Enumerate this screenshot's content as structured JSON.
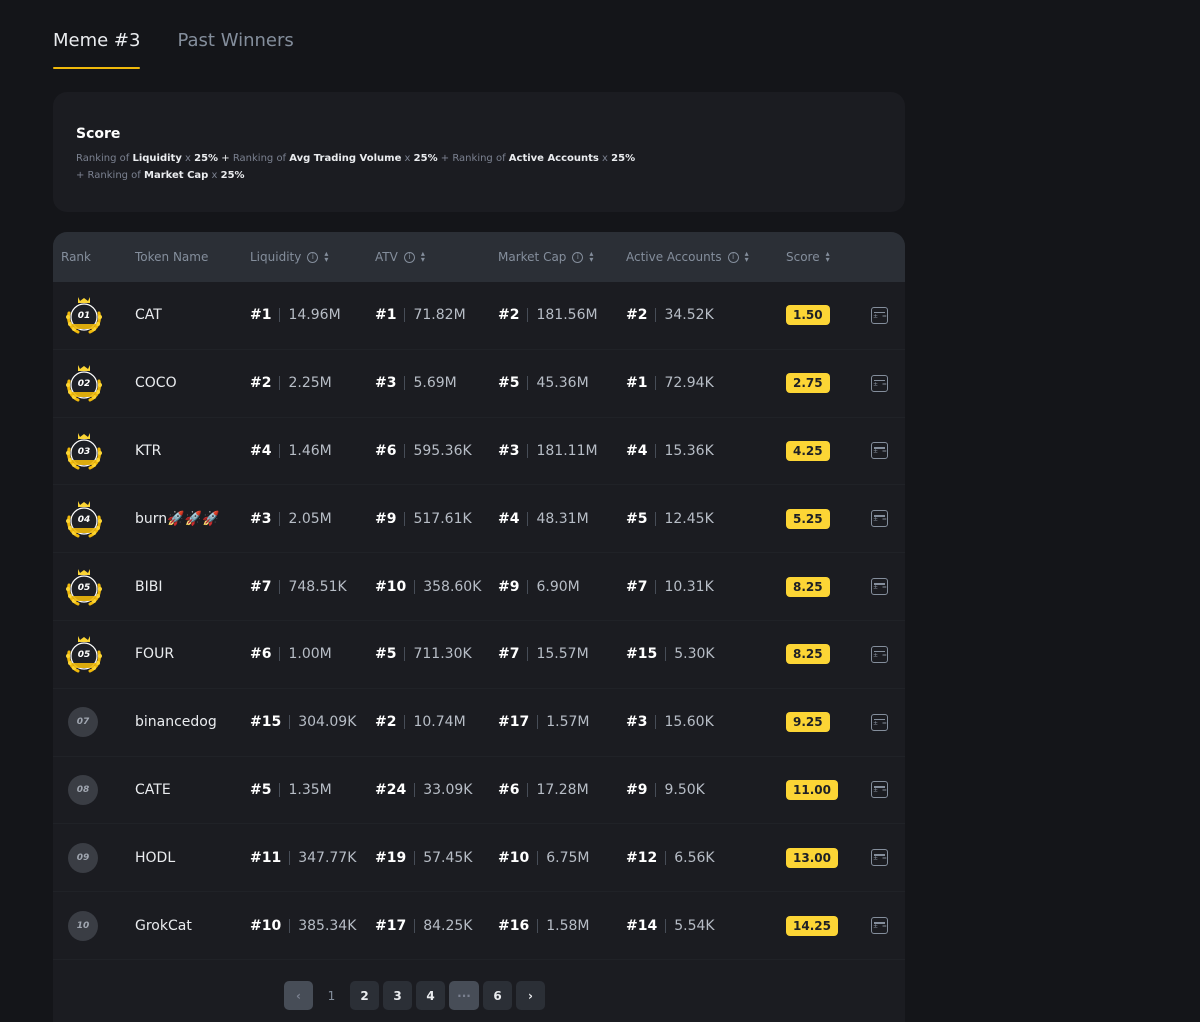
{
  "tabs": [
    {
      "label": "Meme #3",
      "active": true
    },
    {
      "label": "Past Winners",
      "active": false
    }
  ],
  "score": {
    "title": "Score",
    "line1": [
      {
        "t": "Ranking of ",
        "s": "dim"
      },
      {
        "t": "Liquidity",
        "s": "b"
      },
      {
        "t": " x ",
        "s": "dim"
      },
      {
        "t": " 25%",
        "s": "b"
      },
      {
        "t": " + ",
        "s": "op"
      },
      {
        "t": "Ranking of ",
        "s": "dim"
      },
      {
        "t": "Avg Trading Volume",
        "s": "b"
      },
      {
        "t": " x ",
        "s": "dim"
      },
      {
        "t": " 25%",
        "s": "b"
      },
      {
        "t": " + Ranking of ",
        "s": "dim"
      },
      {
        "t": "Active Accounts",
        "s": "b"
      },
      {
        "t": " x ",
        "s": "dim"
      },
      {
        "t": " 25%",
        "s": "b"
      }
    ],
    "line2": [
      {
        "t": "+ Ranking of ",
        "s": "dim"
      },
      {
        "t": "Market Cap",
        "s": "b"
      },
      {
        "t": " x ",
        "s": "dim"
      },
      {
        "t": " 25%",
        "s": "b"
      }
    ]
  },
  "table": {
    "headers": {
      "rank": "Rank",
      "token": "Token Name",
      "liquidity": "Liquidity",
      "atv": "ATV",
      "market_cap": "Market Cap",
      "active_accounts": "Active Accounts",
      "score": "Score"
    },
    "rows": [
      {
        "rank": "01",
        "medal": true,
        "token": "CAT",
        "liq_rank": "#1",
        "liq": "14.96M",
        "atv_rank": "#1",
        "atv": "71.82M",
        "mc_rank": "#2",
        "mc": "181.56M",
        "aa_rank": "#2",
        "aa": "34.52K",
        "score": "1.50"
      },
      {
        "rank": "02",
        "medal": true,
        "token": "COCO",
        "liq_rank": "#2",
        "liq": "2.25M",
        "atv_rank": "#3",
        "atv": "5.69M",
        "mc_rank": "#5",
        "mc": "45.36M",
        "aa_rank": "#1",
        "aa": "72.94K",
        "score": "2.75"
      },
      {
        "rank": "03",
        "medal": true,
        "token": "KTR",
        "liq_rank": "#4",
        "liq": "1.46M",
        "atv_rank": "#6",
        "atv": "595.36K",
        "mc_rank": "#3",
        "mc": "181.11M",
        "aa_rank": "#4",
        "aa": "15.36K",
        "score": "4.25"
      },
      {
        "rank": "04",
        "medal": true,
        "token": "burn🚀🚀🚀",
        "liq_rank": "#3",
        "liq": "2.05M",
        "atv_rank": "#9",
        "atv": "517.61K",
        "mc_rank": "#4",
        "mc": "48.31M",
        "aa_rank": "#5",
        "aa": "12.45K",
        "score": "5.25"
      },
      {
        "rank": "05",
        "medal": true,
        "token": "BIBI",
        "liq_rank": "#7",
        "liq": "748.51K",
        "atv_rank": "#10",
        "atv": "358.60K",
        "mc_rank": "#9",
        "mc": "6.90M",
        "aa_rank": "#7",
        "aa": "10.31K",
        "score": "8.25"
      },
      {
        "rank": "05",
        "medal": true,
        "token": "FOUR",
        "liq_rank": "#6",
        "liq": "1.00M",
        "atv_rank": "#5",
        "atv": "711.30K",
        "mc_rank": "#7",
        "mc": "15.57M",
        "aa_rank": "#15",
        "aa": "5.30K",
        "score": "8.25"
      },
      {
        "rank": "07",
        "medal": false,
        "token": "binancedog",
        "liq_rank": "#15",
        "liq": "304.09K",
        "atv_rank": "#2",
        "atv": "10.74M",
        "mc_rank": "#17",
        "mc": "1.57M",
        "aa_rank": "#3",
        "aa": "15.60K",
        "score": "9.25"
      },
      {
        "rank": "08",
        "medal": false,
        "token": "CATE",
        "liq_rank": "#5",
        "liq": "1.35M",
        "atv_rank": "#24",
        "atv": "33.09K",
        "mc_rank": "#6",
        "mc": "17.28M",
        "aa_rank": "#9",
        "aa": "9.50K",
        "score": "11.00"
      },
      {
        "rank": "09",
        "medal": false,
        "token": "HODL",
        "liq_rank": "#11",
        "liq": "347.77K",
        "atv_rank": "#19",
        "atv": "57.45K",
        "mc_rank": "#10",
        "mc": "6.75M",
        "aa_rank": "#12",
        "aa": "6.56K",
        "score": "13.00"
      },
      {
        "rank": "10",
        "medal": false,
        "token": "GrokCat",
        "liq_rank": "#10",
        "liq": "385.34K",
        "atv_rank": "#17",
        "atv": "84.25K",
        "mc_rank": "#16",
        "mc": "1.58M",
        "aa_rank": "#14",
        "aa": "5.54K",
        "score": "14.25"
      }
    ]
  },
  "pagination": {
    "prev": "‹",
    "pages": [
      "1",
      "2",
      "3",
      "4",
      "···",
      "6"
    ],
    "next": "›"
  },
  "colors": {
    "accent": "#fcd535",
    "background": "#141519",
    "card": "#1b1c21",
    "header": "#2b2f36"
  }
}
